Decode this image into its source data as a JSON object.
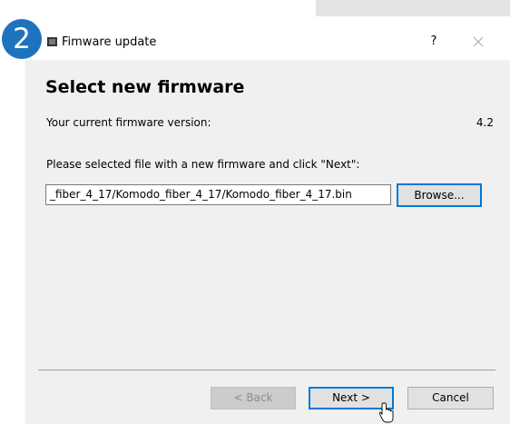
{
  "step_number": "2",
  "window": {
    "title": "Fimware update",
    "help_label": "?",
    "close_icon": "close-icon"
  },
  "page": {
    "heading": "Select new firmware",
    "current_version_label": "Your current firmware version:",
    "current_version_value": "4.2",
    "instruction": "Please selected file with a new firmware and click \"Next\":",
    "file_path": "_fiber_4_17/Komodo_fiber_4_17/Komodo_fiber_4_17.bin"
  },
  "buttons": {
    "browse": "Browse...",
    "back": "< Back",
    "next": "Next >",
    "cancel": "Cancel"
  },
  "colors": {
    "accent": "#0078d7",
    "badge": "#1e73be",
    "dialog_bg": "#f0f0f0"
  }
}
